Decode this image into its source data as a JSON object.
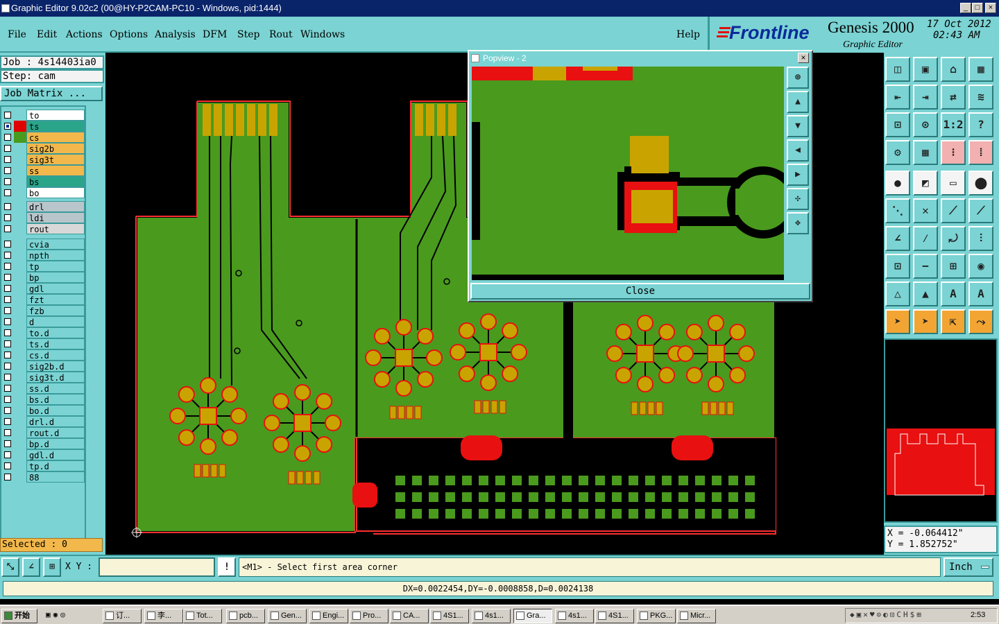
{
  "window": {
    "title": "Graphic Editor 9.02c2 (00@HY-P2CAM-PC10 - Windows, pid:1444)"
  },
  "menu": [
    "File",
    "Edit",
    "Actions",
    "Options",
    "Analysis",
    "DFM",
    "Step",
    "Rout",
    "Windows"
  ],
  "help": "Help",
  "brand": {
    "logo": "Frontline",
    "product": "Genesis 2000",
    "subtitle": "Graphic Editor",
    "date": "17 Oct 2012",
    "time": "02:43 AM"
  },
  "job": {
    "label": "Job : 4s14403ia0",
    "step": "Step: cam",
    "matrix_button": "Job Matrix ..."
  },
  "layers_top": [
    {
      "name": "to",
      "color": "#ffffff",
      "swatch": "#7bd3d3",
      "checked": false
    },
    {
      "name": "ts",
      "color": "#2aa58a",
      "swatch": "#e00000",
      "checked": true
    },
    {
      "name": "cs",
      "color": "#f2b84b",
      "swatch": "#4a9a1e",
      "checked": false
    },
    {
      "name": "sig2b",
      "color": "#f2b84b",
      "swatch": "#7bd3d3",
      "checked": false
    },
    {
      "name": "sig3t",
      "color": "#f2b84b",
      "swatch": "#7bd3d3",
      "checked": false
    },
    {
      "name": "ss",
      "color": "#f2b84b",
      "swatch": "#7bd3d3",
      "checked": false
    },
    {
      "name": "bs",
      "color": "#2aa58a",
      "swatch": "#7bd3d3",
      "checked": false
    },
    {
      "name": "bo",
      "color": "#ffffff",
      "swatch": "#7bd3d3",
      "checked": false
    }
  ],
  "layers_mid": [
    {
      "name": "drl",
      "color": "#b8c6cc"
    },
    {
      "name": "ldi",
      "color": "#b8c6cc"
    },
    {
      "name": "rout",
      "color": "#d8d8d8"
    }
  ],
  "layers_bottom": [
    "cvia",
    "npth",
    "tp",
    "bp",
    "gdl",
    "fzt",
    "fzb",
    "d",
    "to.d",
    "ts.d",
    "cs.d",
    "sig2b.d",
    "sig3t.d",
    "ss.d",
    "bs.d",
    "bo.d",
    "drl.d",
    "rout.d",
    "bp.d",
    "gdl.d",
    "tp.d",
    "88"
  ],
  "selected": "Selected : 0",
  "popview": {
    "title": "Popview - 2",
    "close": "Close"
  },
  "coords": {
    "x": "X = -0.064412\"",
    "y": "Y = 1.852752\""
  },
  "command": {
    "xy_label": "X Y :",
    "input_value": "",
    "prompt": "<M1> - Select first area corner",
    "units": "Inch"
  },
  "status": "DX=0.0022454,DY=-0.0008858,D=0.0024138",
  "taskbar": {
    "start": "开始",
    "items": [
      "订...",
      "李...",
      "Tot...",
      "pcb...",
      "Gen...",
      "Engi...",
      "Pro...",
      "CA...",
      "4S1...",
      "4s1...",
      "Gra...",
      "4s1...",
      "4S1...",
      "PKG...",
      "Micr..."
    ],
    "clock": "2:53"
  }
}
